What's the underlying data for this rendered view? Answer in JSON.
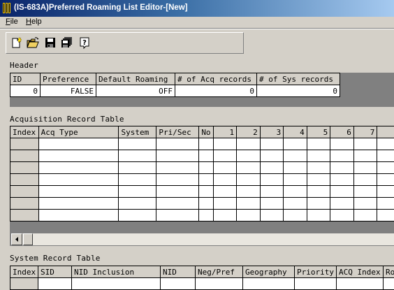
{
  "window": {
    "title": "(IS-683A)Preferred Roaming List Editor-[New]"
  },
  "menu": {
    "file": "File",
    "help": "Help"
  },
  "toolbar": {
    "buttons": [
      {
        "name": "new-file-icon"
      },
      {
        "name": "open-folder-icon"
      },
      {
        "name": "save-disk-icon"
      },
      {
        "name": "save-all-icon"
      },
      {
        "name": "help-question-icon"
      }
    ]
  },
  "header_section": {
    "label": "Header",
    "columns": [
      "ID",
      "Preference",
      "Default Roaming",
      "# of Acq records",
      "# of Sys records"
    ],
    "row": [
      "0",
      "FALSE",
      "OFF",
      "0",
      "0"
    ]
  },
  "acq_section": {
    "label": "Acquisition Record Table",
    "columns": [
      "Index",
      "Acq Type",
      "System",
      "Pri/Sec",
      "No",
      "1",
      "2",
      "3",
      "4",
      "5",
      "6",
      "7",
      "8"
    ],
    "row_count": 7
  },
  "sys_section": {
    "label": "System Record Table",
    "columns": [
      "Index",
      "SID",
      "NID Inclusion",
      "NID",
      "Neg/Pref",
      "Geography",
      "Priority",
      "ACQ Index",
      "Ro"
    ]
  }
}
